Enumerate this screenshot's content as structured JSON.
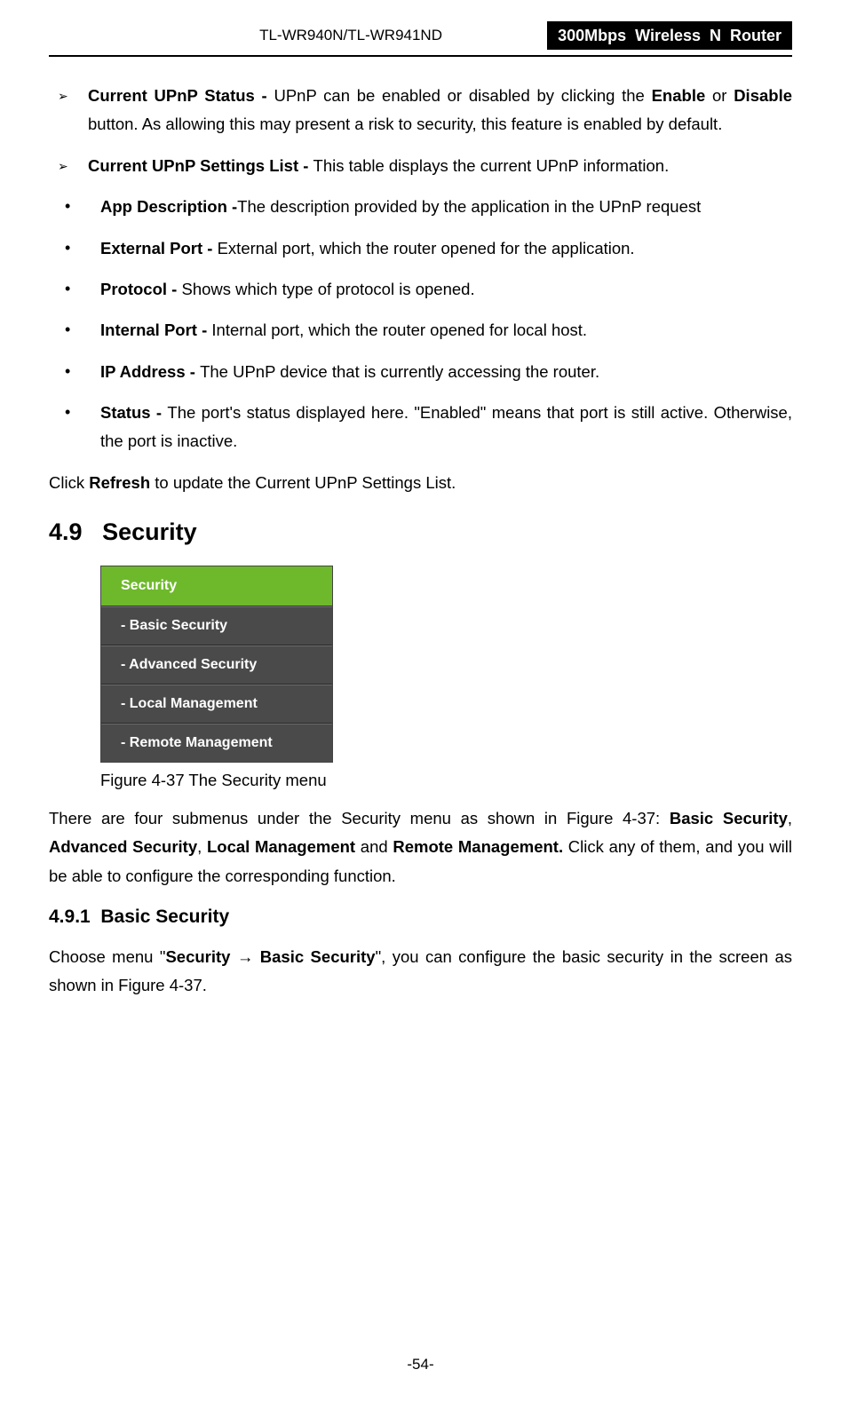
{
  "header": {
    "model": "TL-WR940N/TL-WR941ND",
    "device": "300Mbps  Wireless  N  Router"
  },
  "ul_main": [
    {
      "bold": "Current UPnP Status - ",
      "text_a": "UPnP can be enabled or disabled by clicking the ",
      "bold2": "Enable",
      "text_b": " or ",
      "bold3": "Disable",
      "text_c": " button. As allowing this may present a risk to security, this feature is enabled by default."
    },
    {
      "bold": "Current UPnP Settings List - ",
      "text_a": "This table displays the current UPnP information."
    }
  ],
  "ul_sub": [
    {
      "bold": "App Description -",
      "text": "The description provided by the application in the UPnP request"
    },
    {
      "bold": "External Port - ",
      "text": "External port, which the router opened for the application."
    },
    {
      "bold": "Protocol - ",
      "text": "Shows which type of protocol is opened."
    },
    {
      "bold": "Internal Port - ",
      "text": "Internal port, which the router opened for local host."
    },
    {
      "bold": "IP Address - ",
      "text": "The UPnP device that is currently accessing the router."
    },
    {
      "bold": "Status - ",
      "text": "The port's status displayed here. \"Enabled\" means that port is still active. Otherwise, the port is inactive."
    }
  ],
  "para_refresh_a": "Click ",
  "para_refresh_b": "Refresh",
  "para_refresh_c": " to update the Current UPnP Settings List.",
  "section": {
    "num": "4.9",
    "title": "Security"
  },
  "menu": {
    "head": "Security",
    "items": [
      "- Basic Security",
      "- Advanced Security",
      "- Local Management",
      "- Remote Management"
    ]
  },
  "figure_caption": "Figure 4-37    The Security menu",
  "para_submenus": {
    "a": "There are four submenus under the Security menu as shown in Figure 4-37: ",
    "b1": "Basic Security",
    "c1": ", ",
    "b2": "Advanced Security",
    "c2": ", ",
    "b3": "Local Management",
    "c3": " and ",
    "b4": "Remote Management.",
    "d": " Click any of them, and you will be able to configure the corresponding function."
  },
  "subsection": {
    "num": "4.9.1",
    "title": "Basic Security"
  },
  "para_choose": {
    "a": "Choose menu \"",
    "b1": "Security",
    "arrow": " → ",
    "b2": "Basic Security",
    "c": "\", you can configure the basic security in the screen as shown in Figure 4-37."
  },
  "page_number": "-54-"
}
